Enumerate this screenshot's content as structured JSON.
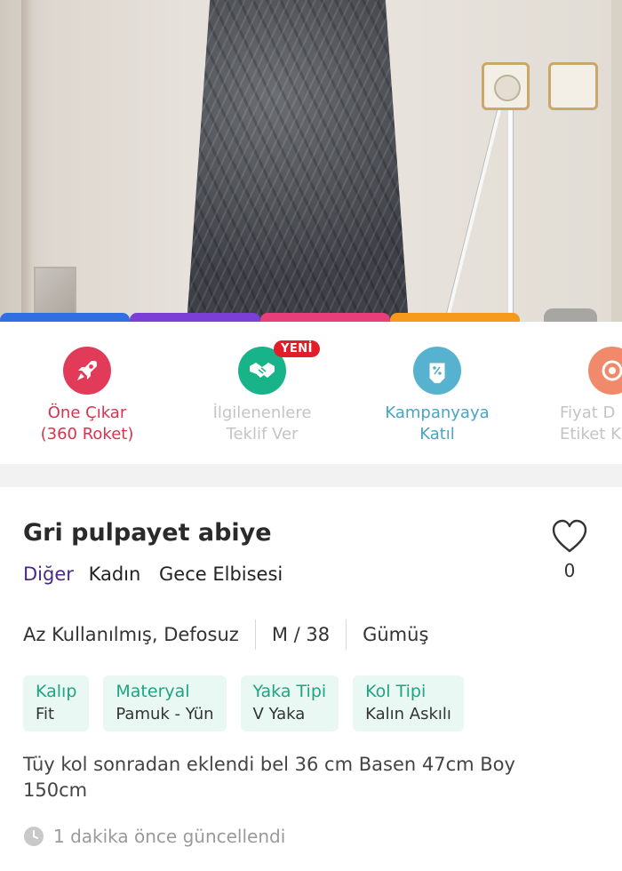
{
  "actions": [
    {
      "label_line1": "Öne Çıkar",
      "label_line2": "(360 Roket)",
      "icon": "rocket-icon",
      "color": "#e23b5a",
      "text_color": "#d8324f",
      "enabled": true
    },
    {
      "label_line1": "İlgilenenlere",
      "label_line2": "Teklif Ver",
      "icon": "handshake-icon",
      "color": "#19b38a",
      "text_color": "#c4c4c4",
      "enabled": false,
      "badge": "YENİ"
    },
    {
      "label_line1": "Kampanyaya",
      "label_line2": "Katıl",
      "icon": "discount-tag-icon",
      "color": "#56b2cf",
      "text_color": "#4aa3c0",
      "enabled": true
    },
    {
      "label_line1": "Fiyat D",
      "label_line2": "Etiket K",
      "icon": "price-label-icon",
      "color": "#f08a6b",
      "text_color": "#c4c4c4",
      "enabled": false
    }
  ],
  "product": {
    "title": "Gri pulpayet abiye",
    "brand": "Diğer",
    "categories": [
      "Kadın",
      "Gece Elbisesi"
    ],
    "like_count": "0",
    "specs": [
      "Az Kullanılmış, Defosuz",
      "M / 38",
      "Gümüş"
    ],
    "attributes": [
      {
        "key": "Kalıp",
        "value": "Fit"
      },
      {
        "key": "Materyal",
        "value": "Pamuk - Yün"
      },
      {
        "key": "Yaka Tipi",
        "value": "V Yaka"
      },
      {
        "key": "Kol Tipi",
        "value": "Kalın Askılı"
      }
    ],
    "description": "Tüy kol sonradan eklendi bel 36 cm Basen 47cm Boy 150cm",
    "updated": "1 dakika önce güncellendi"
  },
  "colors": {
    "brand_purple": "#4b2a86",
    "attr_key_green": "#1ea57f",
    "attr_bg": "#eaf8f3",
    "strip": [
      "#2f6fe0",
      "#7b3fd6",
      "#e83f7a",
      "#f59a1c"
    ]
  }
}
